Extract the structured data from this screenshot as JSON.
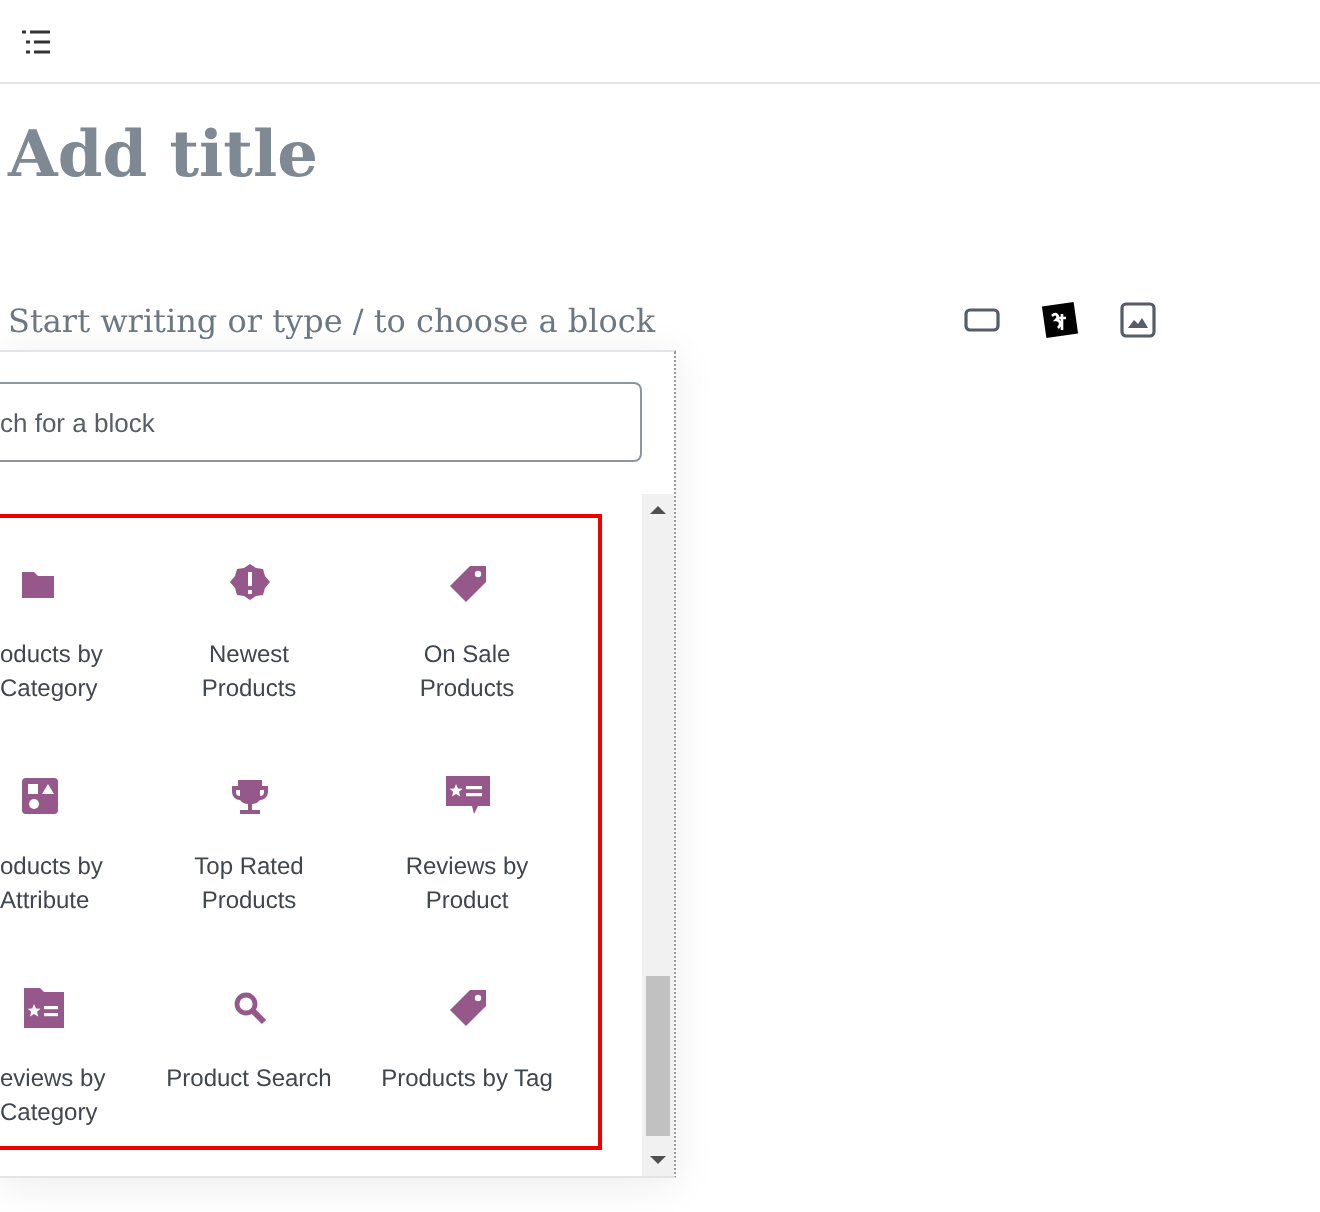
{
  "editor": {
    "title_placeholder": "Add title",
    "paragraph_placeholder": "Start writing or type / to choose a block"
  },
  "inserter": {
    "search": {
      "placeholder": "ch for a block"
    },
    "blocks": [
      {
        "label": "oducts by\nCategory",
        "kind": "folder"
      },
      {
        "label": "Newest\nProducts",
        "kind": "badge"
      },
      {
        "label": "On Sale\nProducts",
        "kind": "tag"
      },
      {
        "label": "oducts by\nAttribute",
        "kind": "shapes"
      },
      {
        "label": "Top Rated\nProducts",
        "kind": "trophy"
      },
      {
        "label": "Reviews by\nProduct",
        "kind": "review"
      },
      {
        "label": "eviews by\nCategory",
        "kind": "folderreview"
      },
      {
        "label": "Product Search",
        "kind": "search"
      },
      {
        "label": "Products by Tag",
        "kind": "tag"
      }
    ]
  }
}
